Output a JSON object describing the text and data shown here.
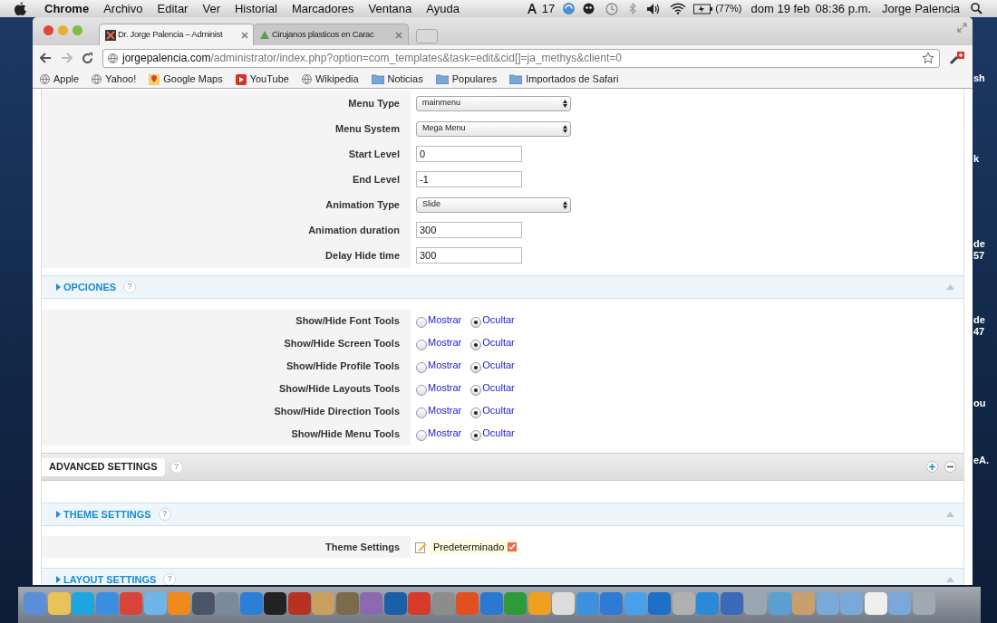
{
  "menu_bar": {
    "app": "Chrome",
    "menus": [
      "Archivo",
      "Editar",
      "Ver",
      "Historial",
      "Marcadores",
      "Ventana",
      "Ayuda"
    ],
    "status": {
      "badge_count": "17",
      "battery": "(77%)",
      "date": "dom 19 feb",
      "time": "08:36 p.m.",
      "user": "Jorge Palencia"
    }
  },
  "browser": {
    "tabs": [
      {
        "title": "Dr. Jorge Palencia – Administ",
        "selected": true
      },
      {
        "title": "Cirujanos plasticos en Carac",
        "selected": false
      }
    ],
    "address": {
      "host": "jorgepalencia.com",
      "path": "/administrator/index.php?option=com_templates&task=edit&cid[]=ja_methys&client=0"
    },
    "bookmarks": [
      {
        "label": "Apple",
        "kind": "page"
      },
      {
        "label": "Yahoo!",
        "kind": "page"
      },
      {
        "label": "Google Maps",
        "kind": "maps"
      },
      {
        "label": "YouTube",
        "kind": "video"
      },
      {
        "label": "Wikipedia",
        "kind": "page"
      },
      {
        "label": "Noticias",
        "kind": "folder"
      },
      {
        "label": "Populares",
        "kind": "folder"
      },
      {
        "label": "Importados de Safari",
        "kind": "folder"
      }
    ]
  },
  "form_rows": [
    {
      "label": "Menu Type",
      "kind": "select",
      "value": "mainmenu"
    },
    {
      "label": "Menu System",
      "kind": "select",
      "value": "Mega Menu"
    },
    {
      "label": "Start Level",
      "kind": "text",
      "value": "0"
    },
    {
      "label": "End Level",
      "kind": "text",
      "value": "-1"
    },
    {
      "label": "Animation Type",
      "kind": "select",
      "value": "Slide"
    },
    {
      "label": "Animation duration",
      "kind": "text",
      "value": "300"
    },
    {
      "label": "Delay Hide time",
      "kind": "text",
      "value": "300"
    }
  ],
  "options_section": {
    "title": "OPCIONES",
    "help": "?",
    "rows": [
      {
        "label": "Show/Hide Font Tools",
        "options": [
          {
            "label": "Mostrar",
            "selected": false
          },
          {
            "label": "Ocultar",
            "selected": true
          }
        ]
      },
      {
        "label": "Show/Hide Screen Tools",
        "options": [
          {
            "label": "Mostrar",
            "selected": false
          },
          {
            "label": "Ocultar",
            "selected": true
          }
        ]
      },
      {
        "label": "Show/Hide Profile Tools",
        "options": [
          {
            "label": "Mostrar",
            "selected": false
          },
          {
            "label": "Ocultar",
            "selected": true
          }
        ]
      },
      {
        "label": "Show/Hide Layouts Tools",
        "options": [
          {
            "label": "Mostrar",
            "selected": false
          },
          {
            "label": "Ocultar",
            "selected": true
          }
        ]
      },
      {
        "label": "Show/Hide Direction Tools",
        "options": [
          {
            "label": "Mostrar",
            "selected": false
          },
          {
            "label": "Ocultar",
            "selected": true
          }
        ]
      },
      {
        "label": "Show/Hide Menu Tools",
        "options": [
          {
            "label": "Mostrar",
            "selected": false
          },
          {
            "label": "Ocultar",
            "selected": true
          }
        ]
      }
    ]
  },
  "advanced": {
    "title": "ADVANCED SETTINGS",
    "help": "?"
  },
  "theme_section": {
    "title": "THEME SETTINGS",
    "help": "?",
    "row": {
      "label": "Theme Settings",
      "value": "Predeterminado"
    }
  },
  "layout_section": {
    "title": "LAYOUT SETTINGS",
    "help": "?"
  },
  "desktop_labels": [
    "sh",
    "k",
    "de",
    "57",
    "de",
    "47",
    "ou",
    "eA."
  ],
  "dock": [
    {
      "color": "#5a8fd8"
    },
    {
      "color": "#e8c35a"
    },
    {
      "color": "#1fa6e0"
    },
    {
      "color": "#3b8fe0"
    },
    {
      "color": "#d9443a"
    },
    {
      "color": "#6fb5e8"
    },
    {
      "color": "#f08a1c"
    },
    {
      "color": "#4a5566"
    },
    {
      "color": "#7a8a9a"
    },
    {
      "color": "#2c7fd6"
    },
    {
      "color": "#222222"
    },
    {
      "color": "#b83224"
    },
    {
      "color": "#c9a060"
    },
    {
      "color": "#7d6a4a"
    },
    {
      "color": "#8a6ab0"
    },
    {
      "color": "#1b5fa8"
    },
    {
      "color": "#d63a2a"
    },
    {
      "color": "#8c8c8c"
    },
    {
      "color": "#e05020"
    },
    {
      "color": "#2b78d0"
    },
    {
      "color": "#2f9a3a"
    },
    {
      "color": "#f0a020"
    },
    {
      "color": "#dcdcdc"
    },
    {
      "color": "#3d8fe0"
    },
    {
      "color": "#2f7ad6"
    },
    {
      "color": "#4aa0e8"
    },
    {
      "color": "#1e6fc8"
    },
    {
      "color": "#b0b0b0"
    },
    {
      "color": "#2a8ad8"
    },
    {
      "color": "#3a6ab8"
    },
    {
      "color": "#9aa6b4"
    },
    {
      "color": "#5aa0d0"
    },
    {
      "color": "#c8a070"
    },
    {
      "color": "#7aa8d8"
    },
    {
      "color": "#7aa8d9"
    },
    {
      "color": "#eeeeee"
    },
    {
      "color": "#7aa8da"
    },
    {
      "color": "#a0a8b0"
    }
  ]
}
